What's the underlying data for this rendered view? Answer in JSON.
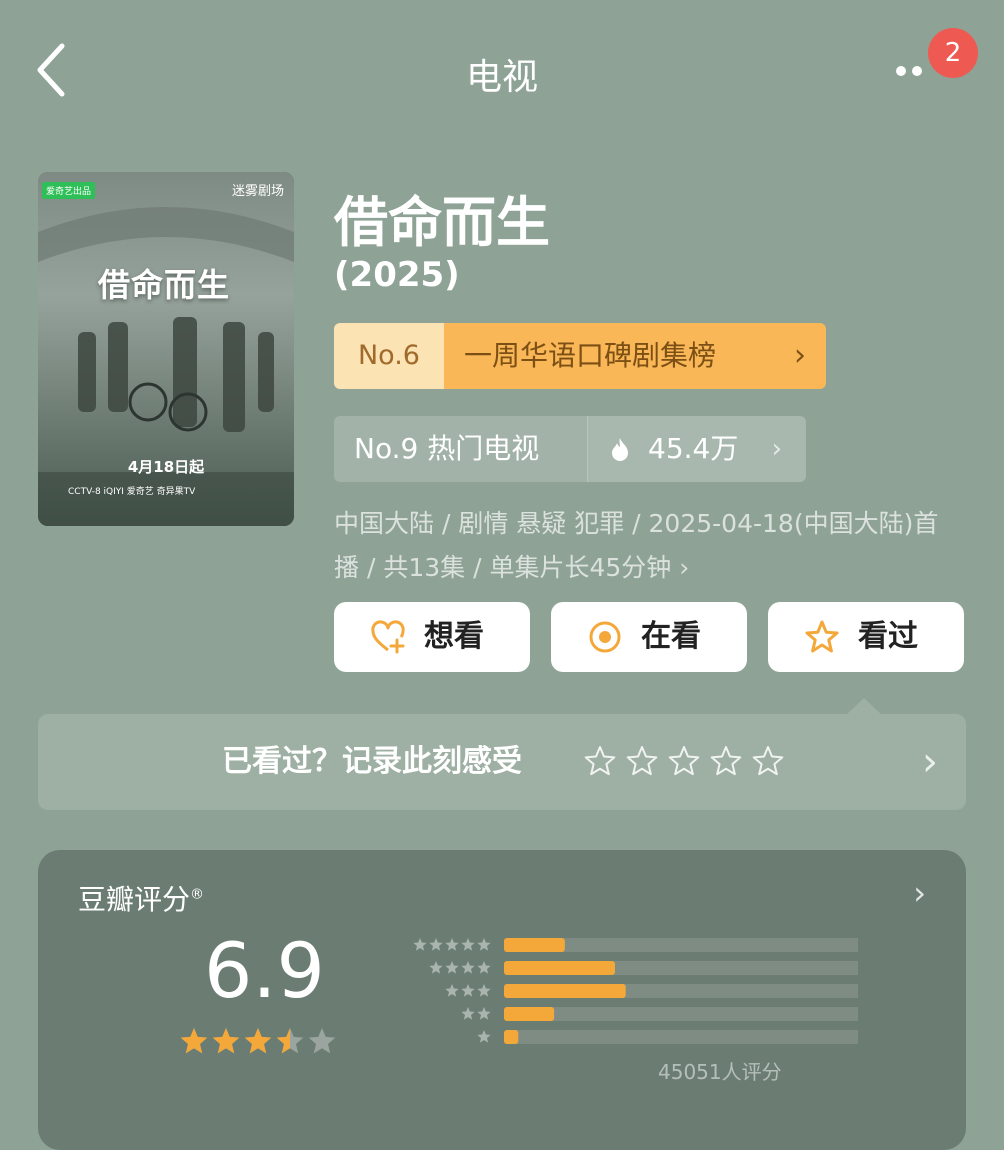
{
  "header": {
    "title": "电视",
    "badge_count": "2"
  },
  "poster": {
    "tag": "爱奇艺出品",
    "studio": "迷雾剧场",
    "title": "借命而生",
    "date": "4月18日起",
    "logos": "CCTV-8  iQIYI 爱奇艺  奇异果TV"
  },
  "show": {
    "title": "借命而生",
    "year": "(2025)"
  },
  "rank": {
    "number": "No.6",
    "name": "一周华语口碑剧集榜",
    "chevron": "›"
  },
  "hot": {
    "label": "No.9 热门电视",
    "count": "45.4万",
    "chevron": "›"
  },
  "meta": {
    "text": "中国大陆 / 剧情 悬疑 犯罪 / 2025-04-18(中国大陆)首播 / 共13集 / 单集片长45分钟 ›"
  },
  "actions": {
    "want": "想看",
    "watching": "在看",
    "watched": "看过"
  },
  "record": {
    "label": "已看过？记录此刻感受",
    "chevron": "›"
  },
  "rating": {
    "label": "豆瓣评分",
    "mark": "®",
    "chevron": "›",
    "value": "6.9",
    "stars": 3.5,
    "count": "45051人评分",
    "distribution": [
      {
        "stars": 5,
        "fraction": 0.17
      },
      {
        "stars": 4,
        "fraction": 0.31
      },
      {
        "stars": 3,
        "fraction": 0.34
      },
      {
        "stars": 2,
        "fraction": 0.14
      },
      {
        "stars": 1,
        "fraction": 0.04
      }
    ]
  },
  "colors": {
    "background": "#8ea296",
    "rank_tag": "#fbe3b3",
    "rank_name": "#f9b757",
    "star": "#f4a83a",
    "badge": "#ee5a52"
  }
}
